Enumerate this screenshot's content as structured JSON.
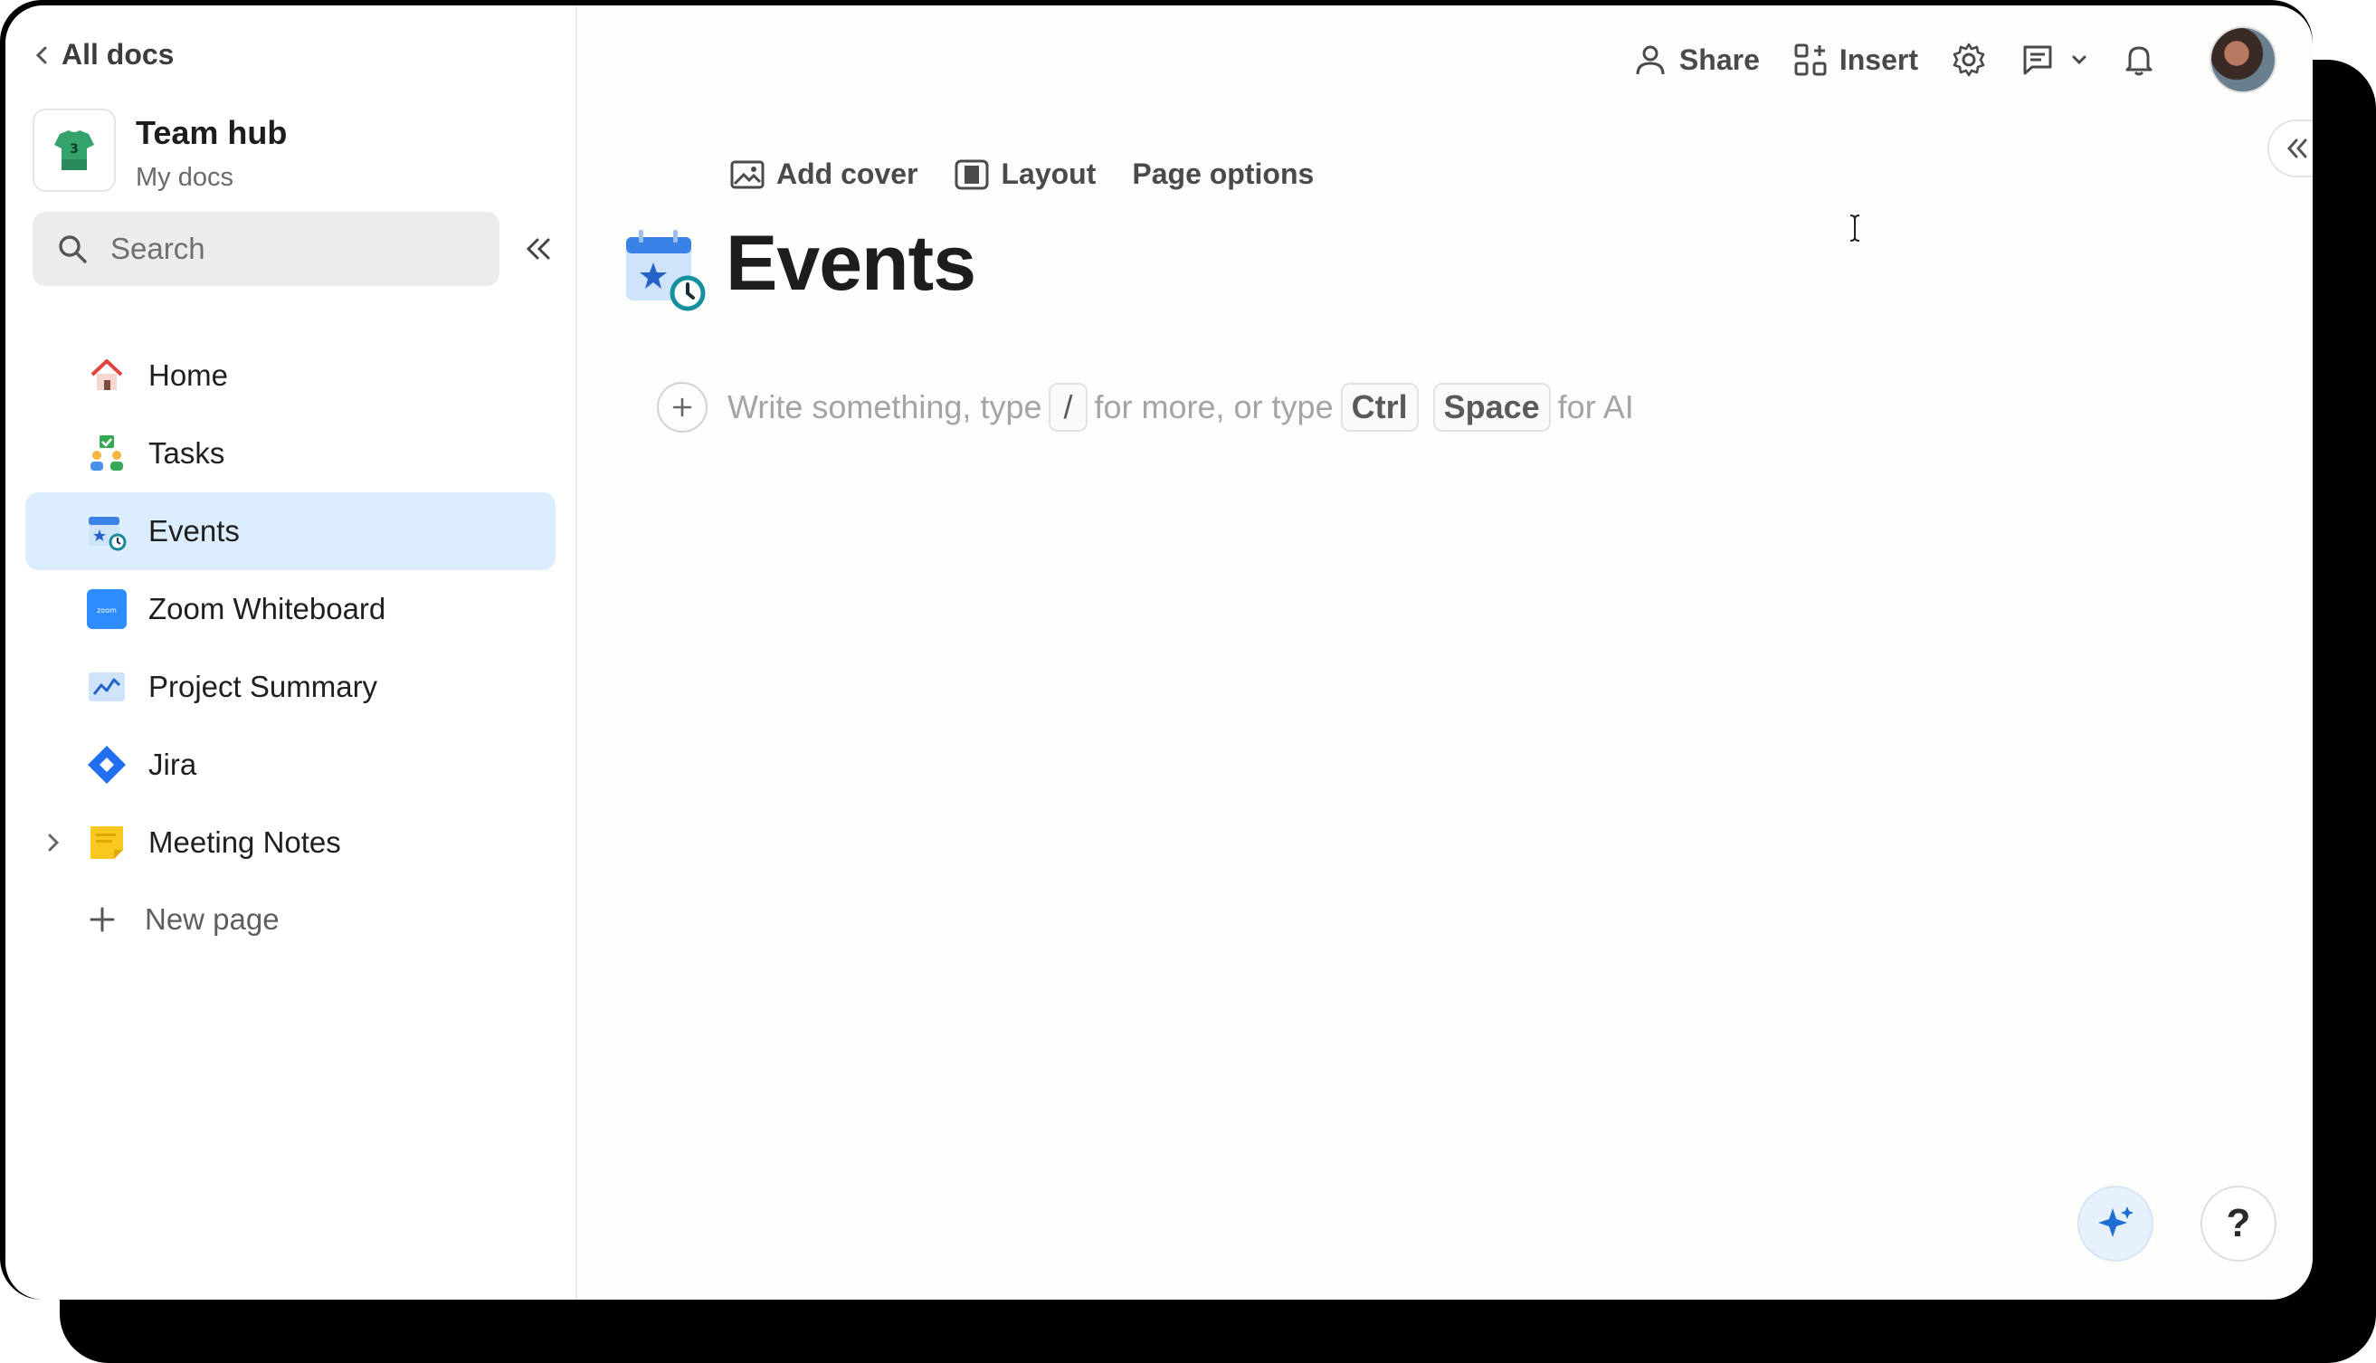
{
  "sidebar": {
    "back_label": "All docs",
    "hub_title": "Team hub",
    "hub_subtitle": "My docs",
    "search_placeholder": "Search",
    "items": [
      {
        "label": "Home",
        "icon": "home-icon"
      },
      {
        "label": "Tasks",
        "icon": "tasks-icon"
      },
      {
        "label": "Events",
        "icon": "events-calendar-icon",
        "active": true
      },
      {
        "label": "Zoom Whiteboard",
        "icon": "zoom-icon"
      },
      {
        "label": "Project Summary",
        "icon": "chart-icon"
      },
      {
        "label": "Jira",
        "icon": "jira-icon"
      },
      {
        "label": "Meeting Notes",
        "icon": "sticky-note-icon",
        "expandable": true
      }
    ],
    "new_page_label": "New page"
  },
  "topbar": {
    "share_label": "Share",
    "insert_label": "Insert"
  },
  "page_toolbar": {
    "add_cover_label": "Add cover",
    "layout_label": "Layout",
    "page_options_label": "Page options"
  },
  "page": {
    "title": "Events",
    "placeholder_part1": "Write something, type",
    "slash_key": "/",
    "placeholder_part2": "for more, or type",
    "ctrl_key": "Ctrl",
    "space_key": "Space",
    "placeholder_part3": "for AI"
  },
  "help_label": "?",
  "colors": {
    "active_item_bg": "#dceefd",
    "accent_blue": "#1a73e8"
  }
}
